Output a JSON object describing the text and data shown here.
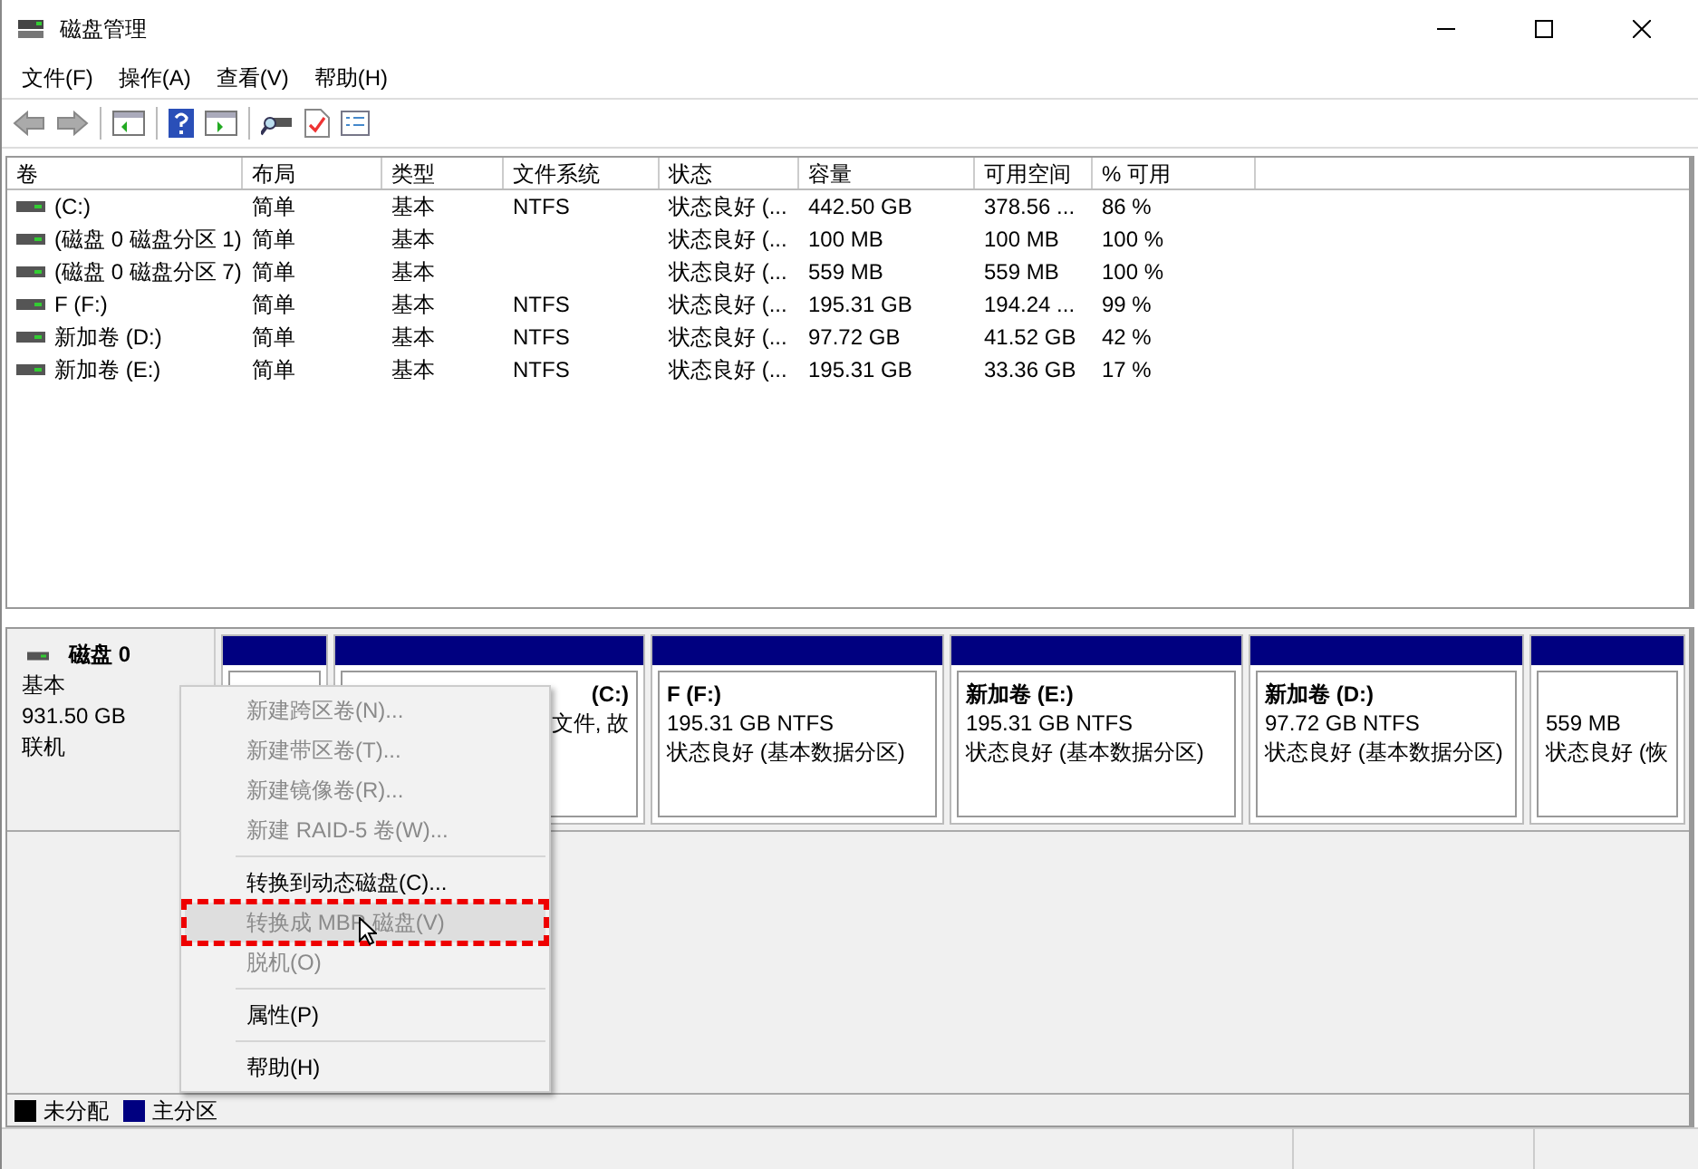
{
  "window": {
    "title": "磁盘管理"
  },
  "menu_bar": [
    "文件(F)",
    "操作(A)",
    "查看(V)",
    "帮助(H)"
  ],
  "table": {
    "columns": [
      "卷",
      "布局",
      "类型",
      "文件系统",
      "状态",
      "容量",
      "可用空间",
      "% 可用"
    ],
    "rows": [
      [
        "(C:)",
        "简单",
        "基本",
        "NTFS",
        "状态良好 (...",
        "442.50 GB",
        "378.56 ...",
        "86 %"
      ],
      [
        "(磁盘 0 磁盘分区 1)",
        "简单",
        "基本",
        "",
        "状态良好 (...",
        "100 MB",
        "100 MB",
        "100 %"
      ],
      [
        "(磁盘 0 磁盘分区 7)",
        "简单",
        "基本",
        "",
        "状态良好 (...",
        "559 MB",
        "559 MB",
        "100 %"
      ],
      [
        "F (F:)",
        "简单",
        "基本",
        "NTFS",
        "状态良好 (...",
        "195.31 GB",
        "194.24 ...",
        "99 %"
      ],
      [
        "新加卷 (D:)",
        "简单",
        "基本",
        "NTFS",
        "状态良好 (...",
        "97.72 GB",
        "41.52 GB",
        "42 %"
      ],
      [
        "新加卷 (E:)",
        "简单",
        "基本",
        "NTFS",
        "状态良好 (...",
        "195.31 GB",
        "33.36 GB",
        "17 %"
      ]
    ]
  },
  "disk": {
    "name": "磁盘 0",
    "type": "基本",
    "size": "931.50 GB",
    "status": "联机",
    "partitions": [
      {
        "kind": "hidden"
      },
      {
        "kind": "volume",
        "title": "(C:)",
        "lines": [
          "文件, 故"
        ]
      },
      {
        "kind": "volume",
        "title": "F  (F:)",
        "lines": [
          "195.31 GB NTFS",
          "状态良好 (基本数据分区)"
        ]
      },
      {
        "kind": "volume",
        "title": "新加卷  (E:)",
        "lines": [
          "195.31 GB NTFS",
          "状态良好 (基本数据分区)"
        ]
      },
      {
        "kind": "volume",
        "title": "新加卷  (D:)",
        "lines": [
          "97.72 GB NTFS",
          "状态良好 (基本数据分区)"
        ]
      },
      {
        "kind": "volume",
        "lines": [
          "559 MB",
          "状态良好 (恢"
        ]
      }
    ]
  },
  "context_menu": [
    {
      "kind": "item",
      "label": "新建跨区卷(N)...",
      "disabled": true,
      "selected": false
    },
    {
      "kind": "item",
      "label": "新建带区卷(T)...",
      "disabled": true,
      "selected": false
    },
    {
      "kind": "item",
      "label": "新建镜像卷(R)...",
      "disabled": true,
      "selected": false
    },
    {
      "kind": "item",
      "label": "新建 RAID-5 卷(W)...",
      "disabled": true,
      "selected": false
    },
    {
      "kind": "separator"
    },
    {
      "kind": "item",
      "label": "转换到动态磁盘(C)...",
      "disabled": false,
      "selected": false
    },
    {
      "kind": "item",
      "label": "转换成 MBR 磁盘(V)",
      "disabled": true,
      "selected": true
    },
    {
      "kind": "item",
      "label": "脱机(O)",
      "disabled": true,
      "selected": false
    },
    {
      "kind": "separator"
    },
    {
      "kind": "item",
      "label": "属性(P)",
      "disabled": false,
      "selected": false
    },
    {
      "kind": "separator"
    },
    {
      "kind": "item",
      "label": "帮助(H)",
      "disabled": false,
      "selected": false
    }
  ],
  "legend": [
    {
      "label": "未分配",
      "color": "#000000"
    },
    {
      "label": "主分区",
      "color": "#000080"
    }
  ]
}
